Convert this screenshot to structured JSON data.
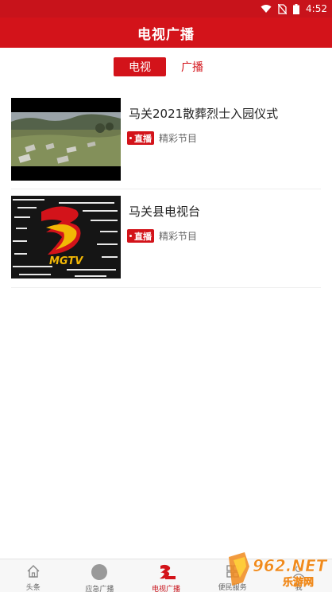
{
  "status_bar": {
    "time": "4:52"
  },
  "header": {
    "title": "电视广播"
  },
  "tabs": [
    {
      "label": "电视",
      "active": true
    },
    {
      "label": "广播",
      "active": false
    }
  ],
  "channels": [
    {
      "title": "马关2021散葬烈士入园仪式",
      "badge": "直播",
      "subtitle": "精彩节目",
      "thumbnail": "cemetery-landscape"
    },
    {
      "title": "马关县电视台",
      "badge": "直播",
      "subtitle": "精彩节目",
      "thumbnail": "mgtv-logo"
    }
  ],
  "thumb_logo_text": "MGTV",
  "bottom_nav": [
    {
      "label": "头条",
      "icon": "home-icon",
      "active": false
    },
    {
      "label": "应急广播",
      "icon": "circle-icon",
      "active": false
    },
    {
      "label": "电视广播",
      "icon": "mgtv-icon",
      "active": true
    },
    {
      "label": "便民服务",
      "icon": "service-icon",
      "active": false
    },
    {
      "label": "我",
      "icon": "user-icon",
      "active": false
    }
  ],
  "watermark": {
    "text": "962.NET",
    "subtext": "乐游网"
  },
  "colors": {
    "brand_red": "#d3131a",
    "status_red": "#c8131b"
  }
}
